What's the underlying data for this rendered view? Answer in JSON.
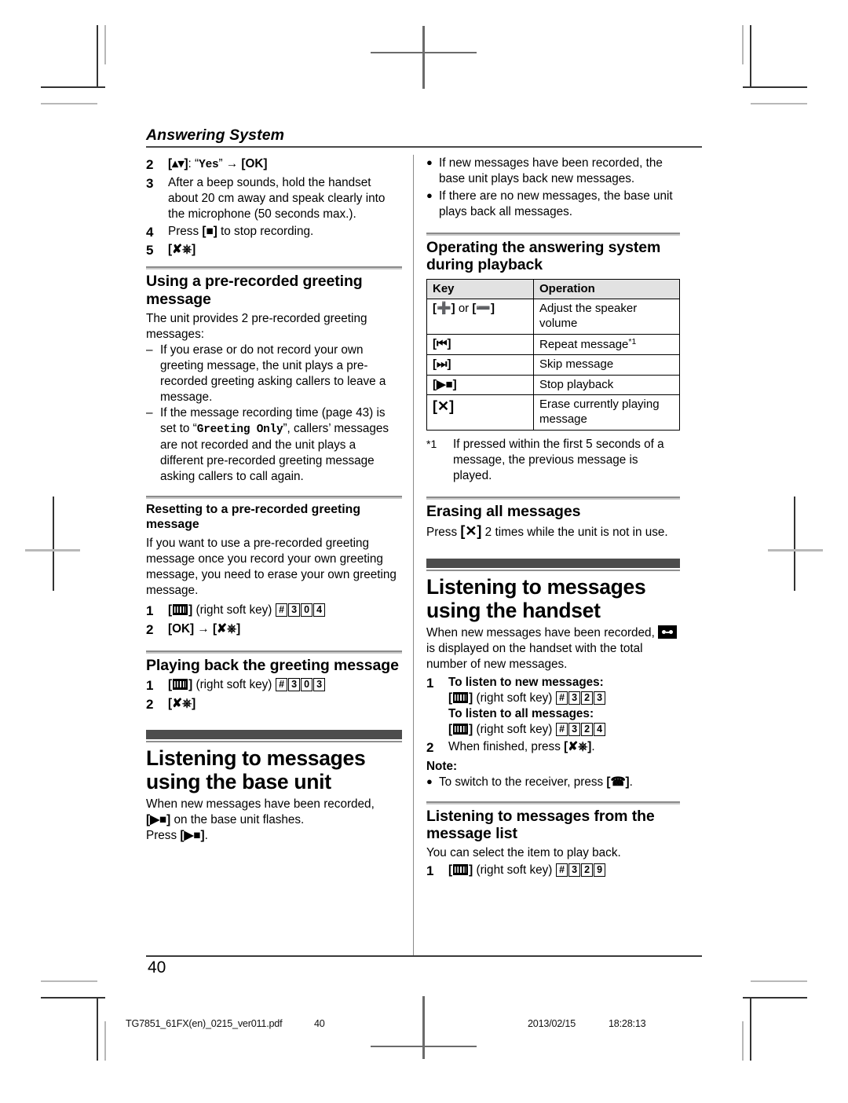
{
  "running_head": "Answering System",
  "page_number": "40",
  "left_column": {
    "steps_top": [
      {
        "num": "2",
        "text_parts": [
          "[",
          "up-down-key",
          "]: “",
          "Yes",
          "” → [OK]"
        ]
      },
      {
        "num": "3",
        "text": "After a beep sounds, hold the handset about 20 cm away and speak clearly into the microphone (50 seconds max.)."
      },
      {
        "num": "4",
        "text": "Press [■] to stop recording."
      },
      {
        "num": "5",
        "text": "[off-key]"
      }
    ],
    "step2_label": "[↕]: “Yes” → [OK]",
    "step2_value": "Yes",
    "step4_label": "Press [■] to stop recording.",
    "section_prerecorded": {
      "title": "Using a pre-recorded greeting message",
      "intro": "The unit provides 2 pre-recorded greeting messages:",
      "dashes": [
        "If you erase or do not record your own greeting message, the unit plays a pre-recorded greeting asking callers to leave a message.",
        {
          "before": "If the message recording time (page 43) is set to “",
          "mono": "Greeting Only",
          "after": "”, callers’ messages are not recorded and the unit plays a different pre-recorded greeting message asking callers to call again."
        }
      ]
    },
    "section_resetting": {
      "title": "Resetting to a pre-recorded greeting message",
      "body": "If you want to use a pre-recorded greeting message once you record your own greeting message, you need to erase your own greeting message.",
      "step1_num": "1",
      "step1_suffix": "(right soft key)",
      "step1_digits": [
        "#",
        "3",
        "0",
        "4"
      ],
      "step2_num": "2",
      "step2_text": "[OK] → [off-key]"
    },
    "section_playing": {
      "title": "Playing back the greeting message",
      "step1_num": "1",
      "step1_suffix": "(right soft key)",
      "step1_digits": [
        "#",
        "3",
        "0",
        "3"
      ],
      "step2_num": "2",
      "step2_text": "[off-key]"
    },
    "section_base_unit": {
      "title": "Listening to messages using the base unit",
      "body_line1": "When new messages have been recorded,",
      "body_line2": "[▶■] on the base unit flashes.",
      "body_line3": "Press [▶■]."
    }
  },
  "right_column": {
    "top_bullets": [
      "If new messages have been recorded, the base unit plays back new messages.",
      "If there are no new messages, the base unit plays back all messages."
    ],
    "section_operating": {
      "title": "Operating the answering system during playback",
      "table": {
        "headers": [
          "Key",
          "Operation"
        ],
        "rows": [
          {
            "key": "[+] or [−]",
            "operation": "Adjust the speaker volume",
            "footnote": ""
          },
          {
            "key": "[⏮]",
            "operation": "Repeat message",
            "footnote": "*1"
          },
          {
            "key": "[⏭]",
            "operation": "Skip message",
            "footnote": ""
          },
          {
            "key": "[▶■]",
            "operation": "Stop playback",
            "footnote": ""
          },
          {
            "key": "[✕]",
            "operation": "Erase currently playing message",
            "footnote": ""
          }
        ]
      },
      "footnote_mark": "*1",
      "footnote_text": "If pressed within the first 5 seconds of a message, the previous message is played."
    },
    "section_erasing": {
      "title": "Erasing all messages",
      "body_before": "Press [",
      "body_after": "] 2 times while the unit is not in use."
    },
    "section_handset": {
      "title": "Listening to messages using the handset",
      "intro_line1": "When new messages have been recorded,",
      "intro_line2_after": "is displayed on the handset with the total number of new messages.",
      "step1_num": "1",
      "step1_head_new": "To listen to new messages:",
      "step1_new_suffix": "(right soft key)",
      "step1_new_digits": [
        "#",
        "3",
        "2",
        "3"
      ],
      "step1_head_all": "To listen to all messages:",
      "step1_all_suffix": "(right soft key)",
      "step1_all_digits": [
        "#",
        "3",
        "2",
        "4"
      ],
      "step2_num": "2",
      "step2_text": "When finished, press [off-key].",
      "note_label": "Note:",
      "note_bullet": "To switch to the receiver, press [talk-key]."
    },
    "section_message_list": {
      "title": "Listening to messages from the message list",
      "body": "You can select the item to play back.",
      "step1_num": "1",
      "step1_suffix": "(right soft key)",
      "step1_digits": [
        "#",
        "3",
        "2",
        "9"
      ]
    }
  },
  "footer": {
    "filename": "TG7851_61FX(en)_0215_ver011.pdf",
    "page": "40",
    "date": "2013/02/15",
    "time": "18:28:13"
  },
  "colors": {
    "rule_dark": "#4a4a4a",
    "bar_dark": "#4d4d4d",
    "table_header_bg": "#e2e2e2",
    "crop_mark": "#6b6b6b"
  }
}
